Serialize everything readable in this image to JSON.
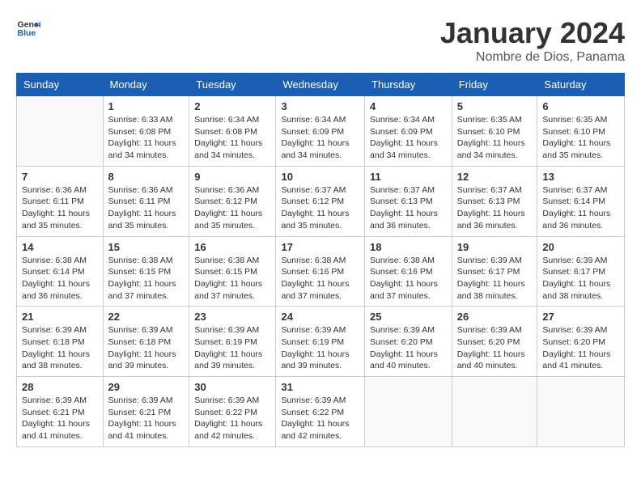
{
  "header": {
    "logo_line1": "General",
    "logo_line2": "Blue",
    "title": "January 2024",
    "subtitle": "Nombre de Dios, Panama"
  },
  "calendar": {
    "days_of_week": [
      "Sunday",
      "Monday",
      "Tuesday",
      "Wednesday",
      "Thursday",
      "Friday",
      "Saturday"
    ],
    "weeks": [
      [
        {
          "day": "",
          "info": ""
        },
        {
          "day": "1",
          "info": "Sunrise: 6:33 AM\nSunset: 6:08 PM\nDaylight: 11 hours\nand 34 minutes."
        },
        {
          "day": "2",
          "info": "Sunrise: 6:34 AM\nSunset: 6:08 PM\nDaylight: 11 hours\nand 34 minutes."
        },
        {
          "day": "3",
          "info": "Sunrise: 6:34 AM\nSunset: 6:09 PM\nDaylight: 11 hours\nand 34 minutes."
        },
        {
          "day": "4",
          "info": "Sunrise: 6:34 AM\nSunset: 6:09 PM\nDaylight: 11 hours\nand 34 minutes."
        },
        {
          "day": "5",
          "info": "Sunrise: 6:35 AM\nSunset: 6:10 PM\nDaylight: 11 hours\nand 34 minutes."
        },
        {
          "day": "6",
          "info": "Sunrise: 6:35 AM\nSunset: 6:10 PM\nDaylight: 11 hours\nand 35 minutes."
        }
      ],
      [
        {
          "day": "7",
          "info": "Sunrise: 6:36 AM\nSunset: 6:11 PM\nDaylight: 11 hours\nand 35 minutes."
        },
        {
          "day": "8",
          "info": "Sunrise: 6:36 AM\nSunset: 6:11 PM\nDaylight: 11 hours\nand 35 minutes."
        },
        {
          "day": "9",
          "info": "Sunrise: 6:36 AM\nSunset: 6:12 PM\nDaylight: 11 hours\nand 35 minutes."
        },
        {
          "day": "10",
          "info": "Sunrise: 6:37 AM\nSunset: 6:12 PM\nDaylight: 11 hours\nand 35 minutes."
        },
        {
          "day": "11",
          "info": "Sunrise: 6:37 AM\nSunset: 6:13 PM\nDaylight: 11 hours\nand 36 minutes."
        },
        {
          "day": "12",
          "info": "Sunrise: 6:37 AM\nSunset: 6:13 PM\nDaylight: 11 hours\nand 36 minutes."
        },
        {
          "day": "13",
          "info": "Sunrise: 6:37 AM\nSunset: 6:14 PM\nDaylight: 11 hours\nand 36 minutes."
        }
      ],
      [
        {
          "day": "14",
          "info": "Sunrise: 6:38 AM\nSunset: 6:14 PM\nDaylight: 11 hours\nand 36 minutes."
        },
        {
          "day": "15",
          "info": "Sunrise: 6:38 AM\nSunset: 6:15 PM\nDaylight: 11 hours\nand 37 minutes."
        },
        {
          "day": "16",
          "info": "Sunrise: 6:38 AM\nSunset: 6:15 PM\nDaylight: 11 hours\nand 37 minutes."
        },
        {
          "day": "17",
          "info": "Sunrise: 6:38 AM\nSunset: 6:16 PM\nDaylight: 11 hours\nand 37 minutes."
        },
        {
          "day": "18",
          "info": "Sunrise: 6:38 AM\nSunset: 6:16 PM\nDaylight: 11 hours\nand 37 minutes."
        },
        {
          "day": "19",
          "info": "Sunrise: 6:39 AM\nSunset: 6:17 PM\nDaylight: 11 hours\nand 38 minutes."
        },
        {
          "day": "20",
          "info": "Sunrise: 6:39 AM\nSunset: 6:17 PM\nDaylight: 11 hours\nand 38 minutes."
        }
      ],
      [
        {
          "day": "21",
          "info": "Sunrise: 6:39 AM\nSunset: 6:18 PM\nDaylight: 11 hours\nand 38 minutes."
        },
        {
          "day": "22",
          "info": "Sunrise: 6:39 AM\nSunset: 6:18 PM\nDaylight: 11 hours\nand 39 minutes."
        },
        {
          "day": "23",
          "info": "Sunrise: 6:39 AM\nSunset: 6:19 PM\nDaylight: 11 hours\nand 39 minutes."
        },
        {
          "day": "24",
          "info": "Sunrise: 6:39 AM\nSunset: 6:19 PM\nDaylight: 11 hours\nand 39 minutes."
        },
        {
          "day": "25",
          "info": "Sunrise: 6:39 AM\nSunset: 6:20 PM\nDaylight: 11 hours\nand 40 minutes."
        },
        {
          "day": "26",
          "info": "Sunrise: 6:39 AM\nSunset: 6:20 PM\nDaylight: 11 hours\nand 40 minutes."
        },
        {
          "day": "27",
          "info": "Sunrise: 6:39 AM\nSunset: 6:20 PM\nDaylight: 11 hours\nand 41 minutes."
        }
      ],
      [
        {
          "day": "28",
          "info": "Sunrise: 6:39 AM\nSunset: 6:21 PM\nDaylight: 11 hours\nand 41 minutes."
        },
        {
          "day": "29",
          "info": "Sunrise: 6:39 AM\nSunset: 6:21 PM\nDaylight: 11 hours\nand 41 minutes."
        },
        {
          "day": "30",
          "info": "Sunrise: 6:39 AM\nSunset: 6:22 PM\nDaylight: 11 hours\nand 42 minutes."
        },
        {
          "day": "31",
          "info": "Sunrise: 6:39 AM\nSunset: 6:22 PM\nDaylight: 11 hours\nand 42 minutes."
        },
        {
          "day": "",
          "info": ""
        },
        {
          "day": "",
          "info": ""
        },
        {
          "day": "",
          "info": ""
        }
      ]
    ]
  }
}
